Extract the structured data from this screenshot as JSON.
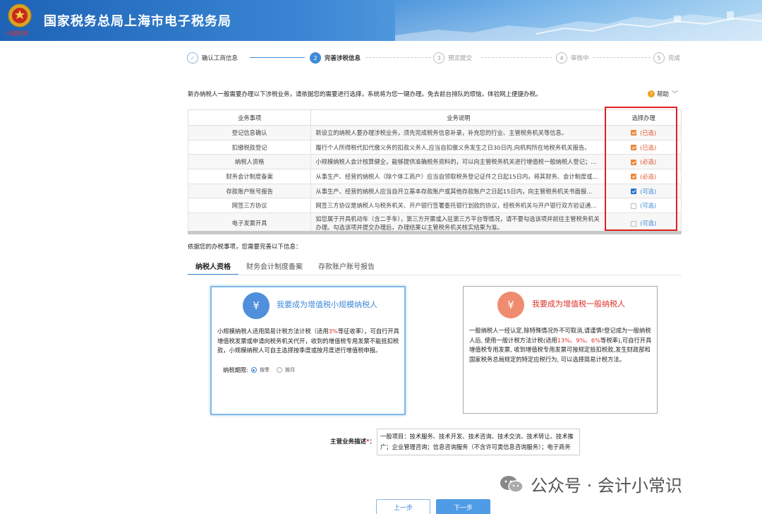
{
  "header": {
    "title": "国家税务总局上海市电子税务局",
    "emblem_text": "中国税务"
  },
  "steps": [
    {
      "num": "✓",
      "label": "确认工商信息",
      "state": "done"
    },
    {
      "num": "2",
      "label": "完善涉税信息",
      "state": "active"
    },
    {
      "num": "3",
      "label": "预览提交",
      "state": "future"
    },
    {
      "num": "4",
      "label": "审核中",
      "state": "future"
    },
    {
      "num": "5",
      "label": "完成",
      "state": "future"
    }
  ],
  "intro": "新办纳税人一般需要办理以下涉税业务，请依据您的需要进行选择，系统将为您一键办理。免去前台排队的烦恼，体验网上便捷办税。",
  "help": {
    "label": "帮助"
  },
  "table": {
    "headers": [
      "业务事项",
      "业务说明",
      "选择办理"
    ],
    "rows": [
      {
        "name": "登记信息确认",
        "desc": "新设立的纳税人要办理涉税业务，须先完成税务信息补录，补充您的行业、主管税务机关等信息。",
        "status": "(已选)",
        "checked": true,
        "color": "orange"
      },
      {
        "name": "扣缴税款登记",
        "desc": "履行个人所得税代扣代缴义务的扣款义务人,应当自扣缴义务发生之日30日内,向机构所在地税务机关报告。",
        "status": "(已选)",
        "checked": true,
        "color": "orange"
      },
      {
        "name": "纳税人资格",
        "desc": "小规模纳税人会计核算健全，能够提供准确税务资料的，可以向主管税务机关进行增值税一般纳税人登记；...",
        "status": "(必选)",
        "checked": true,
        "color": "orange"
      },
      {
        "name": "财务会计制度备案",
        "desc": "从事生产、经营的纳税人（除个体工商户）应当自领取税务登记证件之日起15日内，将其财务、会计制度或...",
        "status": "(必选)",
        "checked": true,
        "color": "orange"
      },
      {
        "name": "存款账户账号报告",
        "desc": "从事生产、经营的纳税人应当自开立基本存款账户或其他存款账户之日起15日内，向主管税务机关书面报...",
        "status": "(可选)",
        "checked": true,
        "color": "blue"
      },
      {
        "name": "网签三方协议",
        "desc": "网签三方协议是纳税人与税务机关、开户银行签署委托银行划款的协议，经税务机关与开户银行双方验证通...",
        "status": "(可选)",
        "checked": false,
        "color": "none"
      },
      {
        "name": "电子发票开具",
        "desc": "如您属于开具机动车（含二手车），第三方开票或入驻第三方平台等情况，请不要勾选该项并前往主管税务机关办理。勾选该项并提交办理后，办理结果以主管税务机关核实结果为准。",
        "status": "(可选)",
        "checked": false,
        "color": "none"
      }
    ]
  },
  "sub_intro": "依据您的办税事项，您需要完善以下信息：",
  "tabs": [
    "纳税人资格",
    "财务会计制度备案",
    "存款账户账号报告"
  ],
  "card_small": {
    "title": "我要成为增值税小规模纳税人",
    "text_a": "小规模纳税人适用简易计税方法计税（适用",
    "text_hl": "3%",
    "text_b": "等征收率），可自行开具增值税发票或申请向税务机关代开，收到的增值税专用发票不能抵扣税款，小规模纳税人可自主选择按季度或按月度进行增值税申报。",
    "period_label": "纳税期限:",
    "opt1": "按季",
    "opt2": "按月"
  },
  "card_general": {
    "title": "我要成为增值税一般纳税人",
    "text_a": "一般纳税人一经认定,除特殊情况外不可取消,请谨慎!登记成为一般纳税人后, 使用一般计税方法计税(适用",
    "text_hl": "13%、9%、6%",
    "text_b": "等税率),可自行开具增值税专用发票, 收到增值税专用发票可按规定抵扣税款,发生财政部和国家税务总局规定的特定应税行为, 可以选择简易计税方法。"
  },
  "business": {
    "label": "主营业务描述",
    "required": "*",
    "colon": "：",
    "value": "一般项目：技术服务、技术开发、技术咨询、技术交流、技术转让、技术推广；企业管理咨询；信息咨询服务（不含许可类信息咨询服务）；电子商务"
  },
  "watermark": "公众号 · 会计小常识",
  "buttons": {
    "prev": "上一步",
    "next": "下一步"
  },
  "colors": {
    "primary": "#3f8ad8",
    "orange": "#e8873a",
    "red": "#e0302a"
  }
}
